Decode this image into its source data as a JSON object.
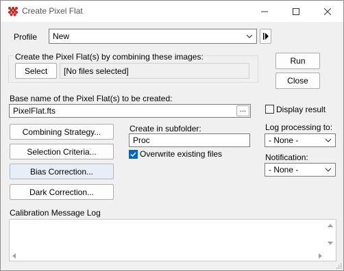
{
  "window": {
    "title": "Create Pixel Flat",
    "minimize_icon": "minimize-icon",
    "maximize_icon": "maximize-icon",
    "close_icon": "close-icon"
  },
  "profile": {
    "label": "Profile",
    "value": "New"
  },
  "combine_group": {
    "label": "Create the Pixel Flat(s) by combining these images:",
    "select_label": "Select",
    "files_value": "[No files selected]"
  },
  "actions": {
    "run_label": "Run",
    "close_label": "Close"
  },
  "base_name": {
    "label": "Base name of the Pixel Flat(s) to be created:",
    "value": "PixelFlat.fts",
    "browse_label": "..."
  },
  "display_result": {
    "label": "Display result",
    "checked": false
  },
  "side_buttons": {
    "combining_label": "Combining Strategy...",
    "selection_label": "Selection Criteria...",
    "bias_label": "Bias Correction...",
    "dark_label": "Dark Correction..."
  },
  "subfolder": {
    "label": "Create in subfolder:",
    "value": "Proc",
    "overwrite_label": "Overwrite existing files",
    "overwrite_checked": true
  },
  "log_processing": {
    "label": "Log processing to:",
    "value": "- None -"
  },
  "notification": {
    "label": "Notification:",
    "value": "- None -"
  },
  "log": {
    "label": "Calibration Message Log",
    "content": ""
  },
  "colors": {
    "accent": "#0067c0",
    "highlight_button": "#e8eef7"
  }
}
